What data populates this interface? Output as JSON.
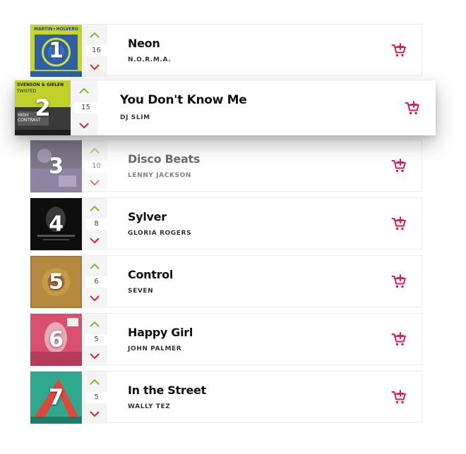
{
  "colors": {
    "up_arrow": "#7bbf2a",
    "down_arrow": "#e0262b",
    "cart": "#e8175d",
    "title_text": "#111111",
    "artist_text": "#333333"
  },
  "tracks": [
    {
      "rank": "1",
      "title": "Neon",
      "artist": "N.O.R.M.A.",
      "votes": "16",
      "cover_palette": "blue-lime",
      "cover_text": "MARTIN+HOLVERG"
    },
    {
      "rank": "2",
      "title": "You Don't Know Me",
      "artist": "DJ SLIM",
      "votes": "15",
      "cover_palette": "lime-dark",
      "cover_text": "SVENSON & GIELEN",
      "cover_subtext": "TWISTED",
      "cover_badge": "HIGH CONTRAST"
    },
    {
      "rank": "3",
      "title": "Disco Beats",
      "artist": "LENNY JACKSON",
      "votes": "10",
      "cover_palette": "purple-night"
    },
    {
      "rank": "4",
      "title": "Sylver",
      "artist": "GLORIA ROGERS",
      "votes": "8",
      "cover_palette": "black-mono"
    },
    {
      "rank": "5",
      "title": "Control",
      "artist": "SEVEN",
      "votes": "6",
      "cover_palette": "gold-ochre"
    },
    {
      "rank": "6",
      "title": "Happy Girl",
      "artist": "JOHN PALMER",
      "votes": "5",
      "cover_palette": "pink-portrait"
    },
    {
      "rank": "7",
      "title": "In the Street",
      "artist": "WALLY TEZ",
      "votes": "5",
      "cover_palette": "teal-red"
    }
  ]
}
